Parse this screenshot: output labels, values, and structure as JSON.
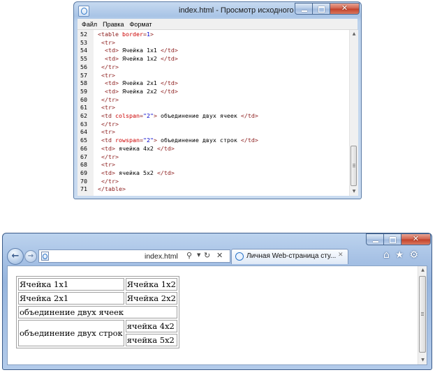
{
  "source_window": {
    "title": "index.html - Просмотр исходного кода",
    "menu": [
      "Файл",
      "Правка",
      "Формат"
    ],
    "lines": [
      {
        "num": "52",
        "indent": 0,
        "parts": [
          [
            "tg",
            "<table "
          ],
          [
            "at",
            "border"
          ],
          [
            "tg",
            "="
          ],
          [
            "av",
            "1"
          ],
          [
            "tg",
            ">"
          ]
        ]
      },
      {
        "num": "53",
        "indent": 1,
        "parts": [
          [
            "tg",
            "<tr>"
          ]
        ]
      },
      {
        "num": "54",
        "indent": 2,
        "parts": [
          [
            "tg",
            "<td>"
          ],
          [
            "tx",
            " Ячейка 1x1 "
          ],
          [
            "tg",
            "</td>"
          ]
        ]
      },
      {
        "num": "55",
        "indent": 2,
        "parts": [
          [
            "tg",
            "<td>"
          ],
          [
            "tx",
            " Ячейка 1x2 "
          ],
          [
            "tg",
            "</td>"
          ]
        ]
      },
      {
        "num": "56",
        "indent": 1,
        "parts": [
          [
            "tg",
            "</tr>"
          ]
        ]
      },
      {
        "num": "57",
        "indent": 1,
        "parts": [
          [
            "tg",
            "<tr>"
          ]
        ]
      },
      {
        "num": "58",
        "indent": 2,
        "parts": [
          [
            "tg",
            "<td>"
          ],
          [
            "tx",
            " Ячейка 2x1 "
          ],
          [
            "tg",
            "</td>"
          ]
        ]
      },
      {
        "num": "59",
        "indent": 2,
        "parts": [
          [
            "tg",
            "<td>"
          ],
          [
            "tx",
            " Ячейка 2x2 "
          ],
          [
            "tg",
            "</td>"
          ]
        ]
      },
      {
        "num": "60",
        "indent": 1,
        "parts": [
          [
            "tg",
            "</tr>"
          ]
        ]
      },
      {
        "num": "61",
        "indent": 1,
        "parts": [
          [
            "tg",
            "<tr>"
          ]
        ]
      },
      {
        "num": "62",
        "indent": 1,
        "parts": [
          [
            "tg",
            "<td "
          ],
          [
            "at",
            "colspan"
          ],
          [
            "tg",
            "="
          ],
          [
            "av",
            "\"2\""
          ],
          [
            "tg",
            ">"
          ],
          [
            "tx",
            " объединение двух ячеек "
          ],
          [
            "tg",
            "</td>"
          ]
        ]
      },
      {
        "num": "63",
        "indent": 1,
        "parts": [
          [
            "tg",
            "</tr>"
          ]
        ]
      },
      {
        "num": "64",
        "indent": 1,
        "parts": [
          [
            "tg",
            "<tr>"
          ]
        ]
      },
      {
        "num": "65",
        "indent": 1,
        "parts": [
          [
            "tg",
            "<td "
          ],
          [
            "at",
            "rowspan"
          ],
          [
            "tg",
            "="
          ],
          [
            "av",
            "\"2\""
          ],
          [
            "tg",
            ">"
          ],
          [
            "tx",
            " объединение двух строк "
          ],
          [
            "tg",
            "</td>"
          ]
        ]
      },
      {
        "num": "66",
        "indent": 1,
        "parts": [
          [
            "tg",
            "<td>"
          ],
          [
            "tx",
            " ячейка 4x2 "
          ],
          [
            "tg",
            "</td>"
          ]
        ]
      },
      {
        "num": "67",
        "indent": 1,
        "parts": [
          [
            "tg",
            "</tr>"
          ]
        ]
      },
      {
        "num": "68",
        "indent": 1,
        "parts": [
          [
            "tg",
            "<tr>"
          ]
        ]
      },
      {
        "num": "69",
        "indent": 1,
        "parts": [
          [
            "tg",
            "<td>"
          ],
          [
            "tx",
            " ячейка 5x2 "
          ],
          [
            "tg",
            "</td>"
          ]
        ]
      },
      {
        "num": "70",
        "indent": 1,
        "parts": [
          [
            "tg",
            "</tr>"
          ]
        ]
      },
      {
        "num": "71",
        "indent": 0,
        "parts": [
          [
            "tg",
            "</table>"
          ]
        ]
      }
    ]
  },
  "browser": {
    "address": "index.html",
    "tab_title": "Личная Web-страница сту...",
    "icons": [
      "home-icon",
      "favorites-star-icon",
      "tools-gear-icon"
    ],
    "table": {
      "r1c1": "Ячейка 1x1",
      "r1c2": "Ячейка 1x2",
      "r2c1": "Ячейка 2x1",
      "r2c2": "Ячейка 2x2",
      "r3": "объединение двух ячеек",
      "r4c1": "объединение двух строк",
      "r4c2": "ячейка 4x2",
      "r5c2": "ячейка 5x2"
    }
  }
}
